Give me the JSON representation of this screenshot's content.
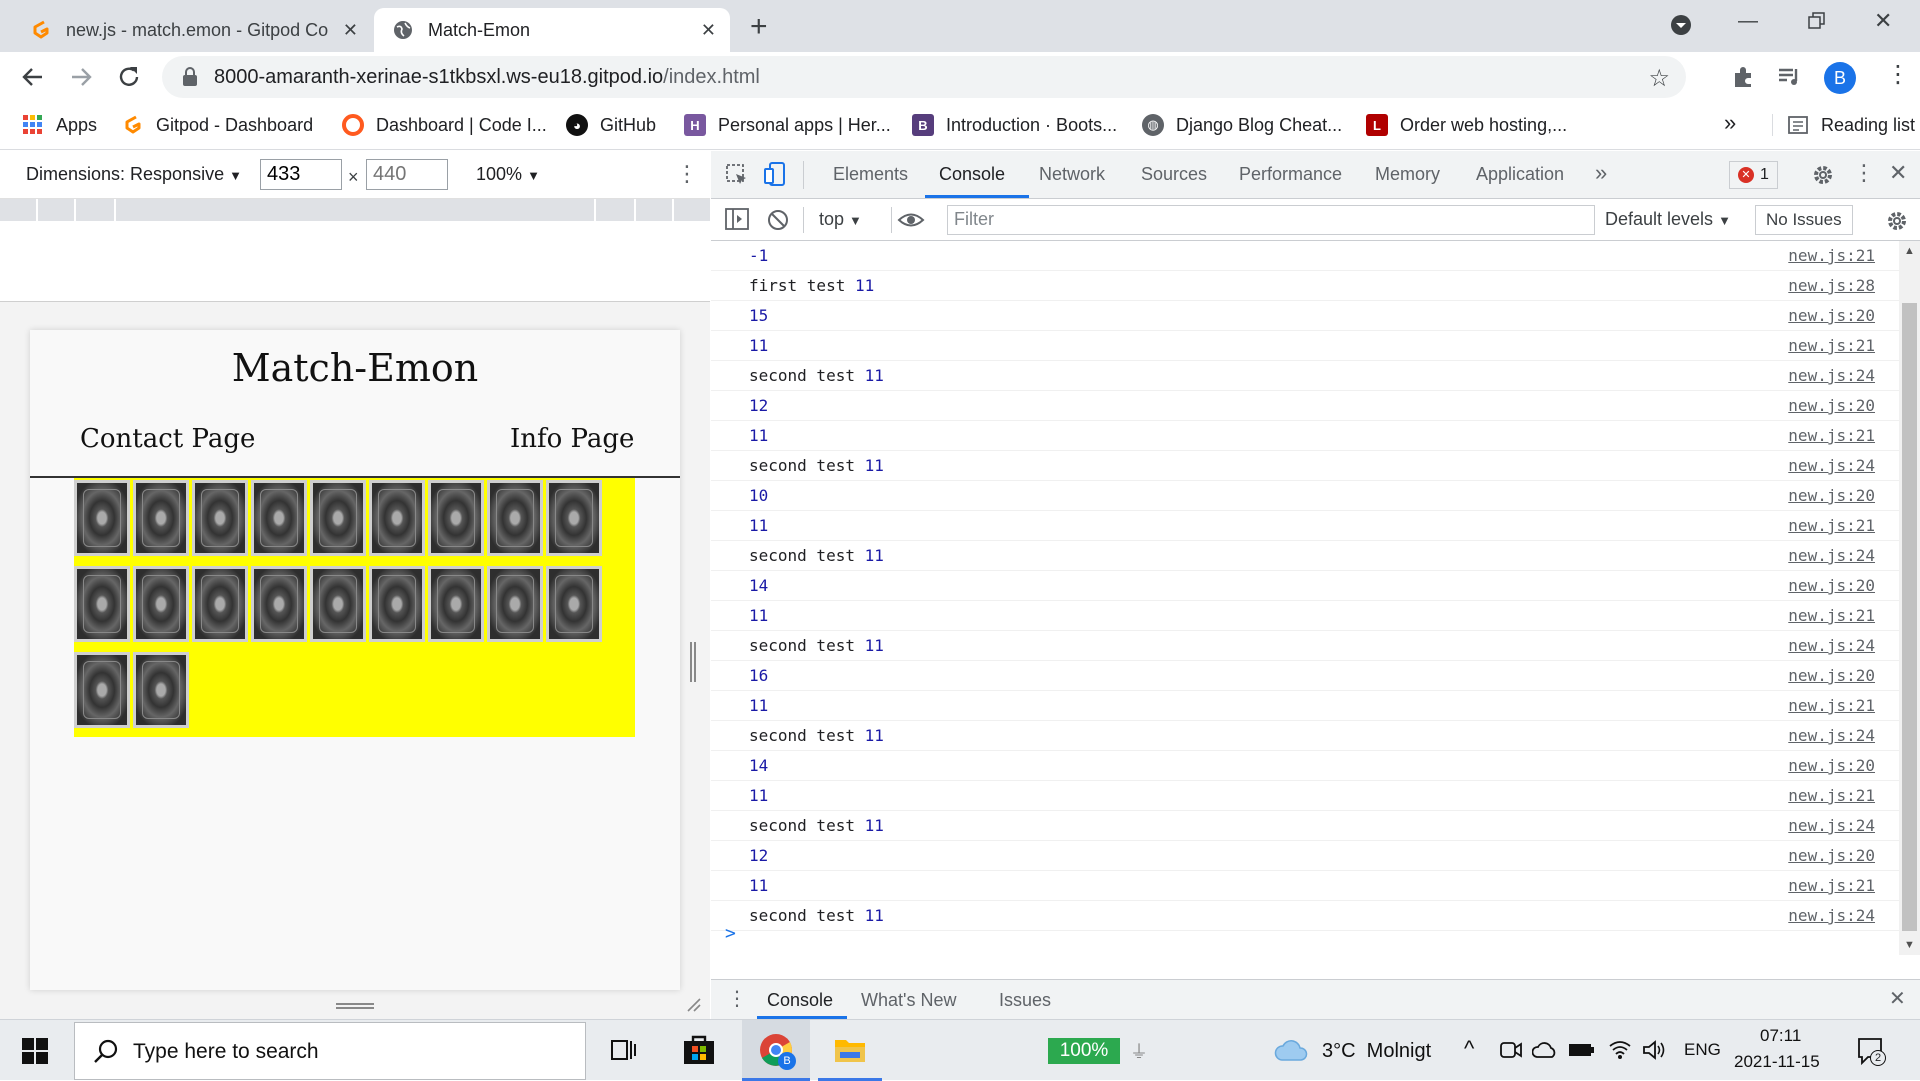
{
  "browser": {
    "tabs": [
      {
        "title": "new.js - match.emon - Gitpod Co",
        "active": false
      },
      {
        "title": "Match-Emon",
        "active": true
      }
    ],
    "url_host": "8000-amaranth-xerinae-s1tkbsxl.ws-eu18.gitpod.io",
    "url_path": "/index.html",
    "profile_initial": "B",
    "bookmarks": [
      {
        "label": "Apps",
        "icon": "apps-grid-icon",
        "color": "#4285f4"
      },
      {
        "label": "Gitpod - Dashboard",
        "icon": "gitpod-icon",
        "color": "#ff8a00"
      },
      {
        "label": "Dashboard | Code I...",
        "icon": "codeinstitute-icon",
        "color": "#ff5a1f"
      },
      {
        "label": "GitHub",
        "icon": "github-icon",
        "color": "#111111"
      },
      {
        "label": "Personal apps | Her...",
        "icon": "heroku-icon",
        "color": "#79589f"
      },
      {
        "label": "Introduction · Boots...",
        "icon": "bootstrap-icon",
        "color": "#563d7c"
      },
      {
        "label": "Django Blog Cheat...",
        "icon": "globe-icon",
        "color": "#5f6368"
      },
      {
        "label": "Order web hosting,...",
        "icon": "hosting-icon",
        "color": "#b00000"
      }
    ],
    "bookmarks_more": "»",
    "reading_list": "Reading list"
  },
  "device_toolbar": {
    "dimensions_label": "Dimensions: Responsive",
    "width": "433",
    "height_placeholder": "440",
    "times": "×",
    "zoom": "100%"
  },
  "page": {
    "title": "Match-Emon",
    "nav_left": "Contact Page",
    "nav_right": "Info Page",
    "card_count": 20,
    "board_color": "#ffff00"
  },
  "devtools": {
    "tabs": [
      "Elements",
      "Console",
      "Network",
      "Sources",
      "Performance",
      "Memory",
      "Application"
    ],
    "active_tab": "Console",
    "more": "»",
    "error_count": "1",
    "context": "top",
    "filter_placeholder": "Filter",
    "levels": "Default levels",
    "issues": "No Issues",
    "prompt": ">",
    "log": [
      {
        "text": "",
        "num": "-1",
        "src": "new.js:21"
      },
      {
        "text": "first test",
        "num": "11",
        "src": "new.js:28"
      },
      {
        "text": "",
        "num": "15",
        "src": "new.js:20"
      },
      {
        "text": "",
        "num": "11",
        "src": "new.js:21"
      },
      {
        "text": "second test",
        "num": "11",
        "src": "new.js:24"
      },
      {
        "text": "",
        "num": "12",
        "src": "new.js:20"
      },
      {
        "text": "",
        "num": "11",
        "src": "new.js:21"
      },
      {
        "text": "second test",
        "num": "11",
        "src": "new.js:24"
      },
      {
        "text": "",
        "num": "10",
        "src": "new.js:20"
      },
      {
        "text": "",
        "num": "11",
        "src": "new.js:21"
      },
      {
        "text": "second test",
        "num": "11",
        "src": "new.js:24"
      },
      {
        "text": "",
        "num": "14",
        "src": "new.js:20"
      },
      {
        "text": "",
        "num": "11",
        "src": "new.js:21"
      },
      {
        "text": "second test",
        "num": "11",
        "src": "new.js:24"
      },
      {
        "text": "",
        "num": "16",
        "src": "new.js:20"
      },
      {
        "text": "",
        "num": "11",
        "src": "new.js:21"
      },
      {
        "text": "second test",
        "num": "11",
        "src": "new.js:24"
      },
      {
        "text": "",
        "num": "14",
        "src": "new.js:20"
      },
      {
        "text": "",
        "num": "11",
        "src": "new.js:21"
      },
      {
        "text": "second test",
        "num": "11",
        "src": "new.js:24"
      },
      {
        "text": "",
        "num": "12",
        "src": "new.js:20"
      },
      {
        "text": "",
        "num": "11",
        "src": "new.js:21"
      },
      {
        "text": "second test",
        "num": "11",
        "src": "new.js:24"
      }
    ],
    "drawer_tabs": [
      "Console",
      "What's New",
      "Issues"
    ]
  },
  "taskbar": {
    "search_placeholder": "Type here to search",
    "battery": "100%",
    "weather": "3°C  Molnigt",
    "language": "ENG",
    "time": "07:11",
    "date": "2021-11-15",
    "notifications": "2"
  }
}
